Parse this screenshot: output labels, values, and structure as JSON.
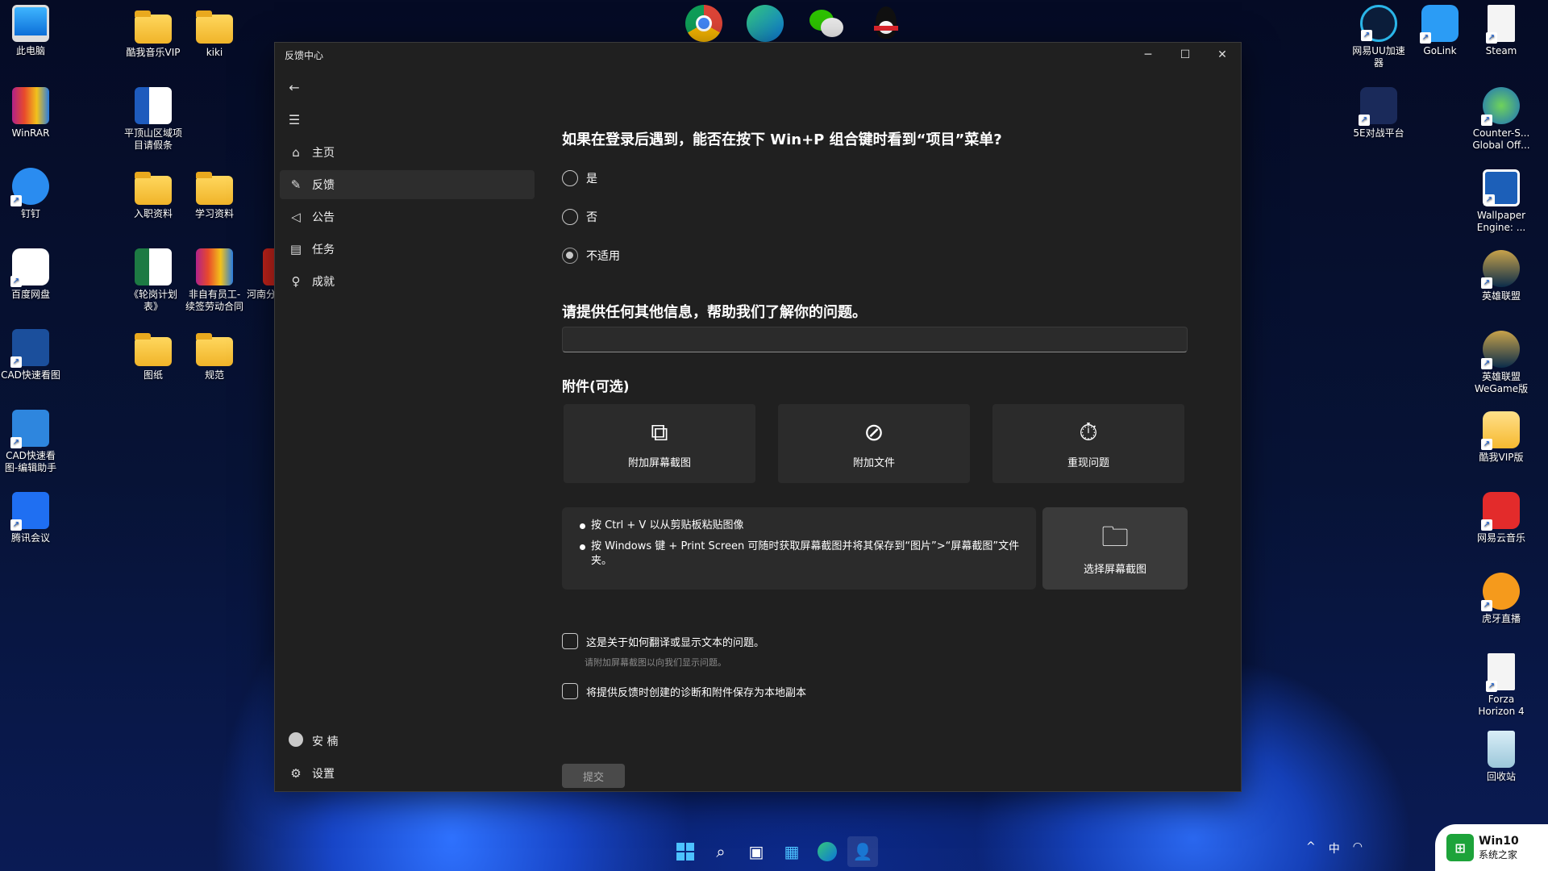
{
  "desktop_left": [
    {
      "label": "此电脑",
      "icon": "computer-icon"
    },
    {
      "label": "WinRAR",
      "icon": "winrar-icon"
    },
    {
      "label": "钉钉",
      "icon": "dingtalk-icon"
    },
    {
      "label": "百度网盘",
      "icon": "baidu-netdisk-icon"
    },
    {
      "label": "CAD快速看图",
      "icon": "cad-viewer-icon"
    },
    {
      "label": "CAD快速看图-编辑助手",
      "icon": "cad-helper-icon"
    },
    {
      "label": "腾讯会议",
      "icon": "tencent-meeting-icon"
    }
  ],
  "desktop_col2": [
    {
      "label": "酷我音乐VIP",
      "icon": "folder-icon"
    },
    {
      "label": "平顶山区域项目请假条",
      "icon": "word-doc-icon"
    },
    {
      "label": "入职资料",
      "icon": "folder-icon"
    },
    {
      "label": "《轮岗计划表》",
      "icon": "excel-doc-icon"
    },
    {
      "label": "图纸",
      "icon": "folder-icon"
    }
  ],
  "desktop_col3": [
    {
      "label": "kiki",
      "icon": "folder-icon"
    },
    {
      "label": "学习资料",
      "icon": "folder-icon"
    },
    {
      "label": "非自有员工-续签劳动合同",
      "icon": "rar-archive-icon"
    },
    {
      "label": "规范",
      "icon": "folder-icon"
    }
  ],
  "desktop_col4": [
    {
      "label": "河南分自有人",
      "icon": "pdf-doc-icon"
    }
  ],
  "desktop_right": [
    {
      "label": "Steam",
      "icon": "steam-file-icon"
    },
    {
      "label": "Counter-S... Global Off...",
      "icon": "csgo-icon"
    },
    {
      "label": "Wallpaper Engine: ...",
      "icon": "wallpaper-engine-icon"
    },
    {
      "label": "英雄联盟",
      "icon": "league-icon"
    },
    {
      "label": "英雄联盟WeGame版",
      "icon": "league-wegame-icon"
    },
    {
      "label": "酷我VIP版",
      "icon": "kuwo-icon"
    },
    {
      "label": "网易云音乐",
      "icon": "netease-music-icon"
    },
    {
      "label": "虎牙直播",
      "icon": "huya-icon"
    },
    {
      "label": "Forza Horizon 4",
      "icon": "forza-file-icon"
    },
    {
      "label": "回收站",
      "icon": "recycle-bin-icon"
    }
  ],
  "desktop_right2": [
    {
      "label": "网易UU加速器",
      "icon": "uu-accelerator-icon"
    },
    {
      "label": "5E对战平台",
      "icon": "5e-platform-icon"
    }
  ],
  "desktop_right3": [
    {
      "label": "GoLink",
      "icon": "golink-icon"
    }
  ],
  "window": {
    "title": "反馈中心",
    "nav": [
      {
        "label": "主页",
        "icon": "home-icon"
      },
      {
        "label": "反馈",
        "icon": "feedback-icon"
      },
      {
        "label": "公告",
        "icon": "megaphone-icon"
      },
      {
        "label": "任务",
        "icon": "quest-icon"
      },
      {
        "label": "成就",
        "icon": "achievement-icon"
      }
    ],
    "user": "安 楠",
    "settings": "设置",
    "question": "如果在登录后遇到，能否在按下 Win+P 组合键时看到“项目”菜单?",
    "options": [
      "是",
      "否",
      "不适用"
    ],
    "selected_option": "不适用",
    "info_title": "请提供任何其他信息，帮助我们了解你的问题。",
    "info_value": "",
    "attach_title": "附件(可选)",
    "attach": [
      {
        "label": "附加屏幕截图",
        "icon": "screenshot-icon"
      },
      {
        "label": "附加文件",
        "icon": "paperclip-icon"
      },
      {
        "label": "重现问题",
        "icon": "stopwatch-icon"
      }
    ],
    "tips": [
      "按 Ctrl + V 以从剪贴板粘贴图像",
      "按 Windows 键 + Print Screen 可随时获取屏幕截图并将其保存到“图片”>“屏幕截图”文件夹。"
    ],
    "select_screenshot": "选择屏幕截图",
    "check1": "这是关于如何翻译或显示文本的问题。",
    "check1_sub": "请附加屏幕截图以向我们显示问题。",
    "check2": "将提供反馈时创建的诊断和附件保存为本地副本",
    "submit": "提交"
  },
  "tray": {
    "ime": "中"
  },
  "watermark": {
    "line1": "Win10",
    "line2": "系统之家"
  }
}
